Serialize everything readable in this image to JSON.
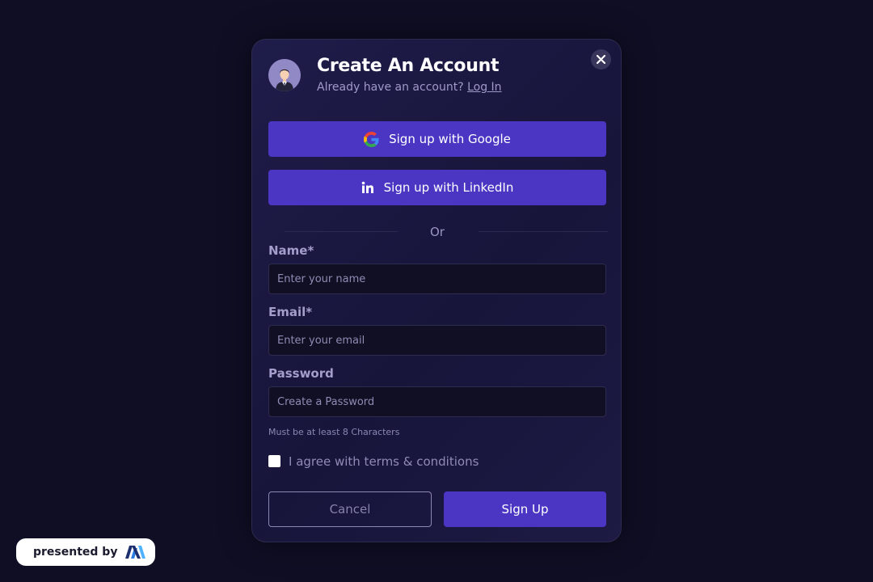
{
  "modal": {
    "title": "Create An Account",
    "subtitle_prefix": "Already have an account?",
    "login_link": "Log In"
  },
  "social": {
    "google_label": "Sign up with Google",
    "linkedin_label": "Sign up with LinkedIn",
    "divider": "Or"
  },
  "form": {
    "name_label": "Name*",
    "name_placeholder": "Enter your name",
    "name_value": "",
    "email_label": "Email*",
    "email_placeholder": "Enter your email",
    "email_value": "",
    "password_label": "Password",
    "password_placeholder": "Create a Password",
    "password_value": "",
    "password_hint": "Must be at least 8 Characters",
    "terms_label": "I agree with terms & conditions",
    "terms_checked": false
  },
  "actions": {
    "cancel_label": "Cancel",
    "signup_label": "Sign Up"
  },
  "badge": {
    "label": "presented by"
  },
  "icons": {
    "close": "close-icon",
    "google": "google-icon",
    "linkedin": "linkedin-icon",
    "avatar": "user-avatar",
    "brand": "brand-logo-icon"
  },
  "colors": {
    "background": "#0f0e24",
    "accent": "#4b36c4",
    "modal_border": "#2d2b4d"
  }
}
